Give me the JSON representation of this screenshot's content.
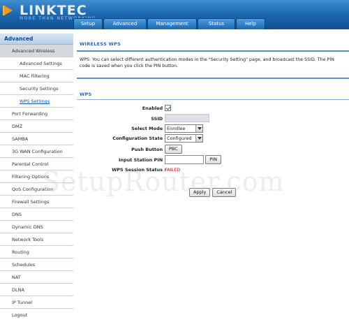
{
  "brand": {
    "name": "LINKTEC",
    "tagline": "MORE THAN NETWORKING"
  },
  "nav": {
    "tabs": [
      "Setup",
      "Advanced",
      "Management",
      "Status",
      "Help"
    ]
  },
  "sidebar": {
    "header": "Advanced",
    "items": [
      "Advanced Wireless",
      "Advanced Settings",
      "MAC Filtering",
      "Security Settings",
      "WPS Settings",
      "Port Forwarding",
      "DMZ",
      "SAMBA",
      "3G WAN Configuration",
      "Parental Control",
      "Filtering Options",
      "QoS Configuration",
      "Firewall Settings",
      "DNS",
      "Dynamic DNS",
      "Network Tools",
      "Routing",
      "Schedules",
      "NAT",
      "DLNA",
      "IP Tunnel",
      "Logout"
    ]
  },
  "main": {
    "section_title": "WIRELESS WPS",
    "description": "WPS: You can select different authentication modes in the \"Security Setting\" page, and broadcast the SSID. The PIN code is saved when you click the PIN button.",
    "wps_title": "WPS",
    "form": {
      "enabled_label": "Enabled :",
      "enabled_checked": true,
      "ssid_label": "SSID :",
      "ssid_value": "",
      "mode_label": "Select Mode :",
      "mode_value": "Enrollee",
      "state_label": "Configuration State :",
      "state_value": "Configured",
      "push_label": "Push Button :",
      "pbc_label": "PBC",
      "pin_label": "Input Station PIN :",
      "pin_value": "",
      "pin_button": "PIN",
      "session_label": "WPS Session Status :",
      "session_value": "FAILED"
    },
    "apply_label": "Apply",
    "cancel_label": "Cancel"
  },
  "watermark": "SetupRouter.com",
  "colors": {
    "header": "#1d6bb3",
    "accent": "#2767ad",
    "error": "#b01616",
    "logo_accent": "#f29a1c"
  }
}
